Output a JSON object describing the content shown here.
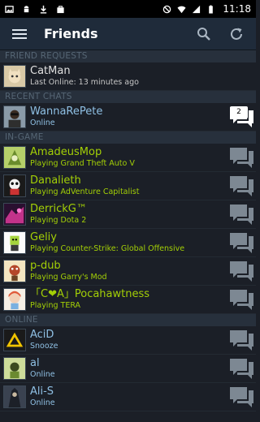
{
  "statusbar": {
    "time": "11:18"
  },
  "appbar": {
    "title": "Friends"
  },
  "sections": {
    "requests": "FRIEND REQUESTS",
    "recent": "RECENT CHATS",
    "ingame": "IN-GAME",
    "online": "ONLINE"
  },
  "requests": [
    {
      "name": "CatMan",
      "status": "Last Online: 13 minutes ago"
    }
  ],
  "recent": [
    {
      "name": "WannaRePete",
      "status": "Online",
      "badge": "2"
    }
  ],
  "ingame": [
    {
      "name": "AmadeusMop",
      "status": "Playing Grand Theft Auto V"
    },
    {
      "name": "Danalieth",
      "status": "Playing AdVenture Capitalist"
    },
    {
      "name": "DerrickG™",
      "status": "Playing Dota 2"
    },
    {
      "name": "Geliy",
      "status": "Playing Counter-Strike: Global Offensive"
    },
    {
      "name": "p-dub",
      "status": "Playing Garry's Mod"
    },
    {
      "name": "「C❤A」Pocahawtness",
      "status": "Playing TERA"
    }
  ],
  "online": [
    {
      "name": "AciD",
      "status": "Snooze"
    },
    {
      "name": "al",
      "status": "Online"
    },
    {
      "name": "Ali-S",
      "status": "Online"
    }
  ],
  "colors": {
    "appbar": "#1f2b3a",
    "ingame": "#a3cf06",
    "online": "#8fc0e4"
  }
}
